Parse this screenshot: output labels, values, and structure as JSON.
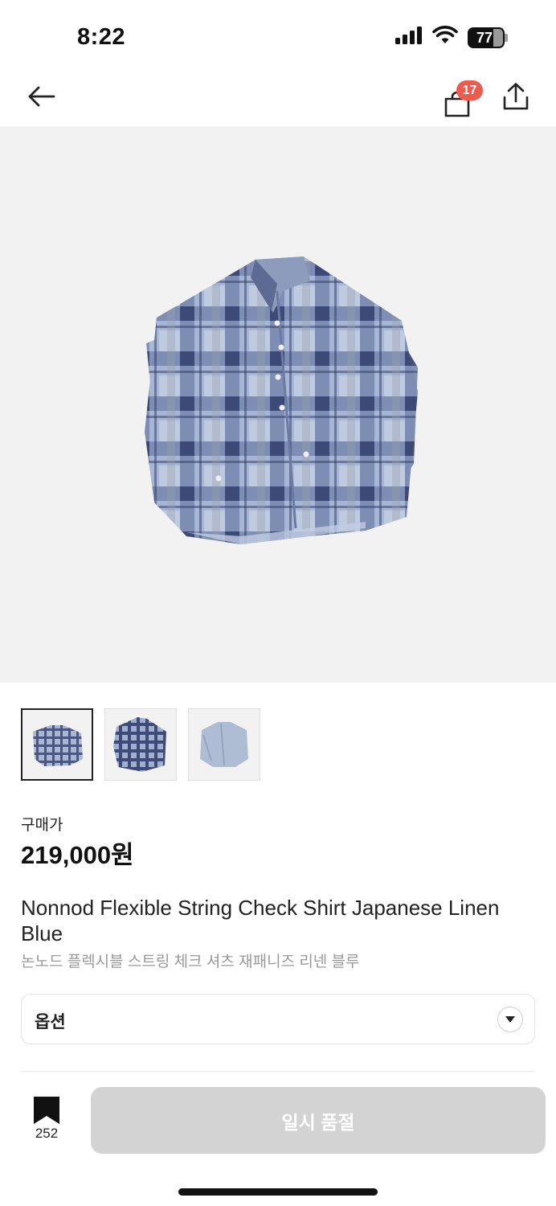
{
  "status_bar": {
    "time": "8:22",
    "battery": "77",
    "battery_level_percent": 77
  },
  "header": {
    "back_icon": "arrow-left-icon",
    "cart_icon": "shopping-bag-icon",
    "cart_badge": "17",
    "share_icon": "share-upload-icon"
  },
  "product": {
    "hero_image": "checked-shirt-image",
    "thumbnails": [
      {
        "name": "shirt-flat-photo",
        "active": true
      },
      {
        "name": "shirt-folded-photo",
        "active": false
      },
      {
        "name": "shirt-light-blue-photo",
        "active": false
      }
    ],
    "price_label": "구매가",
    "price": "219,000원",
    "title_en": "Nonnod Flexible String Check Shirt Japanese Linen Blue",
    "title_ko": "논노드 플렉시블 스트링 체크 셔츠 재패니즈 리넨 블루"
  },
  "option": {
    "label": "옵션",
    "arrow_icon": "caret-down-icon"
  },
  "bottom_bar": {
    "bookmark_icon": "bookmark-icon",
    "bookmark_count": "252",
    "soldout_label": "일시 품절"
  },
  "colors": {
    "badge": "#ef5a4e",
    "soldout_button": "#d3d3d3",
    "hero_background": "#f2f2f2",
    "shirt_blue": "#8fa3c6",
    "shirt_navy": "#3d4a78"
  }
}
